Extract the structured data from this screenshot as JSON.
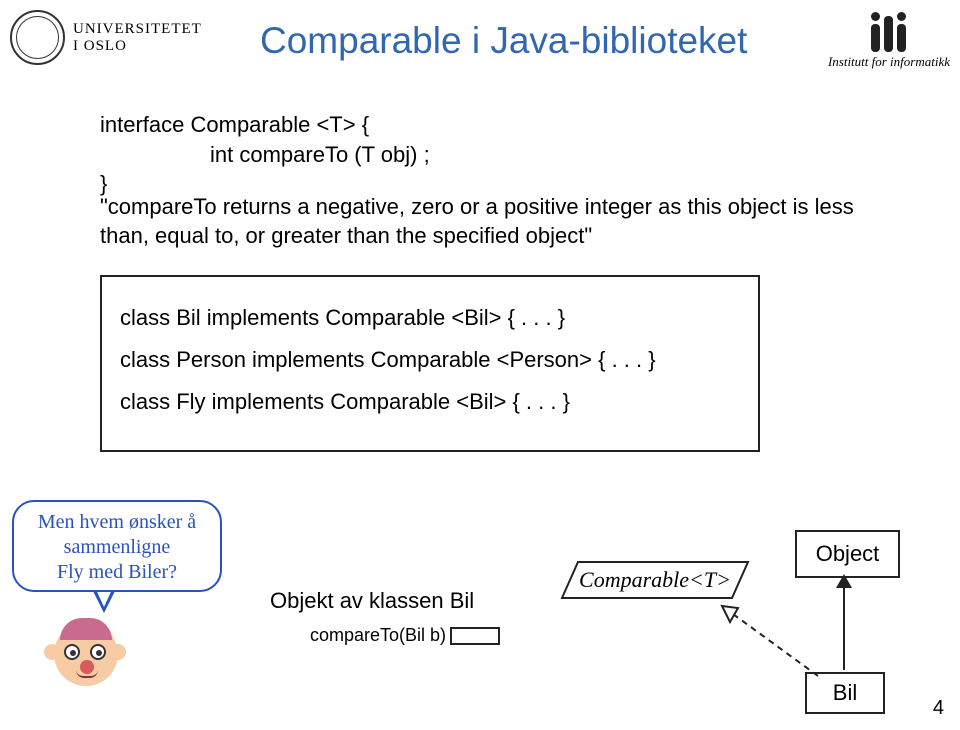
{
  "header": {
    "uio_line1": "UNIVERSITETET",
    "uio_line2": "I OSLO",
    "ifi_label": "Institutt for informatikk"
  },
  "title": "Comparable i Java-biblioteket",
  "code": {
    "iface_line1": "interface Comparable <T> {",
    "iface_line2": "int compareTo (T  obj) ;",
    "iface_line3": "}"
  },
  "quote": "\"compareTo  returns a negative, zero or a positive integer as this object is less than, equal to, or greater than the specified object\"",
  "classbox": {
    "line1": "class Bil implements Comparable <Bil> { . . . }",
    "line2": "class Person implements Comparable <Person> { . . . }",
    "line3": "class Fly implements Comparable <Bil> { . . . }"
  },
  "callout": {
    "line1": "Men hvem ønsker å",
    "line2": "sammenligne",
    "line3": "Fly med Biler?"
  },
  "diagram": {
    "object_caption": "Objekt av klassen Bil",
    "method_label": "compareTo(Bil b)",
    "comparable_label": "Comparable<T>",
    "object_box": "Object",
    "bil_box": "Bil"
  },
  "page_number": "4"
}
